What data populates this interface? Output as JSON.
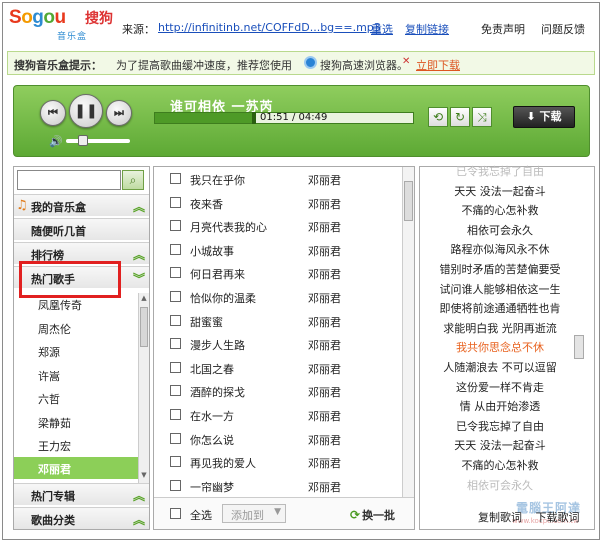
{
  "app": {
    "logo_text": "Sogou",
    "logo_cn": "搜狗",
    "logo_sub": "音乐盒",
    "source_label": "来源：",
    "source_url": "http://infinitinb.net/COFFdD...bg==.mp3",
    "retry": "重选",
    "copy_link": "复制链接",
    "disclaimer": "免责声明",
    "feedback": "问题反馈"
  },
  "tip": {
    "title": "搜狗音乐盒提示：",
    "text1": "为了提高歌曲缓冲速度，推荐您使用",
    "text2": "搜狗高速浏览器。",
    "close_icon": "x-icon",
    "link": "立即下载"
  },
  "player": {
    "song_title": "谁可相依  一苏芮",
    "time": "01:51 / 04:49",
    "progress": 0.383,
    "volume": 0.45,
    "download_label": "下载",
    "icons": [
      "prev-icon",
      "pause-icon",
      "next-icon",
      "volume-icon",
      "repeat-icon",
      "loop-icon",
      "shuffle-icon",
      "download-icon"
    ]
  },
  "sidebar": {
    "search_placeholder": "",
    "my_music": "我的音乐盒",
    "random": "随便听几首",
    "charts": "排行榜",
    "hot_artists": "热门歌手",
    "artists": [
      "凤凰传奇",
      "周杰伦",
      "郑源",
      "许嵩",
      "六哲",
      "梁静茹",
      "王力宏",
      "邓丽君"
    ],
    "active_artist": "邓丽君",
    "hot_albums": "热门专辑",
    "genres": "歌曲分类"
  },
  "songs": {
    "items": [
      {
        "name": "我只在乎你",
        "artist": "邓丽君"
      },
      {
        "name": "夜来香",
        "artist": "邓丽君"
      },
      {
        "name": "月亮代表我的心",
        "artist": "邓丽君"
      },
      {
        "name": "小城故事",
        "artist": "邓丽君"
      },
      {
        "name": "何日君再来",
        "artist": "邓丽君"
      },
      {
        "name": "恰似你的温柔",
        "artist": "邓丽君"
      },
      {
        "name": "甜蜜蜜",
        "artist": "邓丽君"
      },
      {
        "name": "漫步人生路",
        "artist": "邓丽君"
      },
      {
        "name": "北国之春",
        "artist": "邓丽君"
      },
      {
        "name": "酒醉的探戈",
        "artist": "邓丽君"
      },
      {
        "name": "在水一方",
        "artist": "邓丽君"
      },
      {
        "name": "你怎么说",
        "artist": "邓丽君"
      },
      {
        "name": "再见我的爱人",
        "artist": "邓丽君"
      },
      {
        "name": "一帘幽梦",
        "artist": "邓丽君"
      }
    ],
    "select_all": "全选",
    "add_to": "添加到",
    "refresh": "换一批"
  },
  "lyrics": {
    "lines": [
      "已令我忘掉了自由",
      "天天  没法一起奋斗",
      "不痛的心怎补救",
      "相依可会永久",
      "路程亦似海风永不休",
      "错别时矛盾的苦楚偏要受",
      "试问谁人能够相依这一生",
      "即使将前途通通牺牲也肯",
      "求能明白我  光阴再逝流",
      "我共你思念总不休",
      "人随潮浪去  不可以逗留",
      "这份爱一样不肯走",
      "情  从由开始渗透",
      "已令我忘掉了自由",
      "天天  没法一起奋斗",
      "不痛的心怎补救",
      "相依可会永久"
    ],
    "current_index": 9,
    "copy_lyrics": "复制歌词",
    "download_lyrics": "下载歌词",
    "watermark": "電腦王阿達",
    "watermark_url": "www.kocpc.com.tw"
  },
  "colors": {
    "accent_green": "#6cb83e",
    "active_item": "#8ccf58",
    "current_lyric": "#e8621f",
    "highlight_box": "#e12020",
    "link_blue": "#1a4fbb"
  }
}
